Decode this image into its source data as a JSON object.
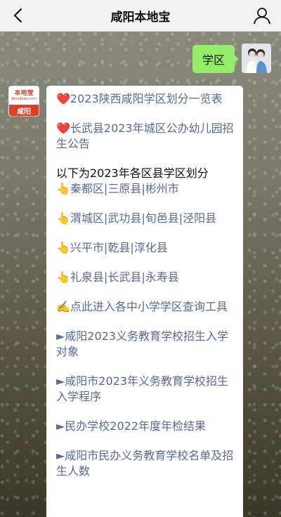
{
  "header": {
    "title": "咸阳本地宝"
  },
  "outgoing": {
    "text": "学区"
  },
  "bot_avatar": {
    "brand": "本地宝",
    "url": "Bendibao.com",
    "city": "咸阳"
  },
  "message": {
    "link1": "❤️2023陕西咸阳学区划分一览表",
    "link2": "❤️长武县2023年城区公办幼儿园招生公告",
    "heading": "以下为2023年各区县学区划分",
    "row1": "👆秦都区|三原县|彬州市",
    "row2": "👆渭城区|武功县|旬邑县|泾阳县",
    "row3": "👆兴平市|乾县|淳化县",
    "row4": "👆礼泉县|长武县|永寿县",
    "link3": "✍️点此进入各中小学学区查询工具",
    "link4": "►咸阳2023义务教育学校招生入学对象",
    "link5": "►咸阳市2023年义务教育学校招生入学程序",
    "link6": "►民办学校2022年度年检结果",
    "link7": "►咸阳市民办义务教育学校名单及招生人数"
  },
  "colors": {
    "link": "#576b95",
    "bubble_green": "#95ec69",
    "brand_red": "#e23b26"
  }
}
